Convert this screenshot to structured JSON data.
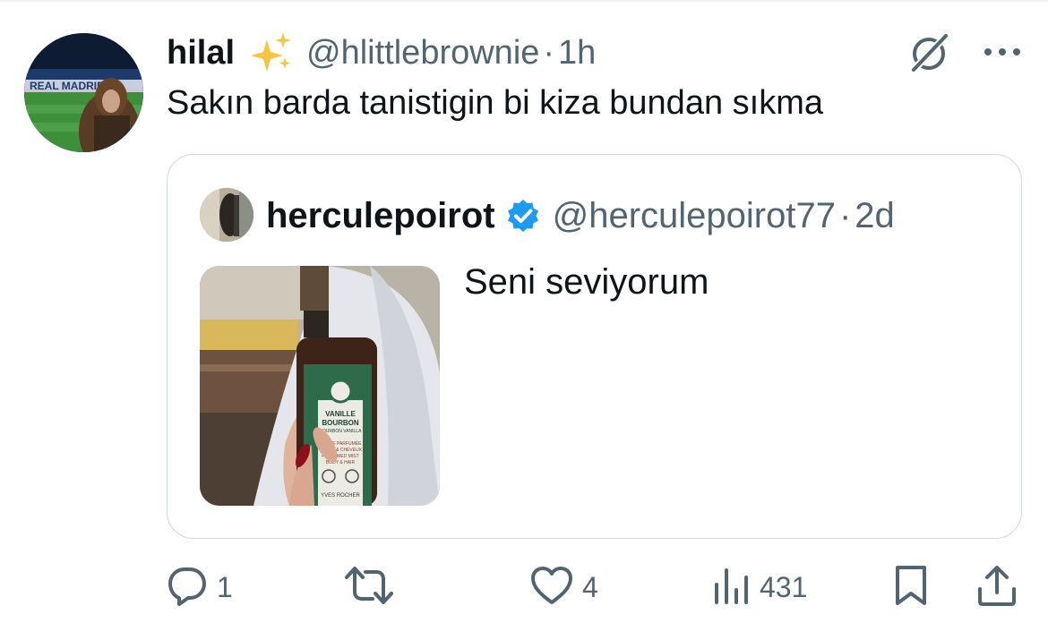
{
  "tweet": {
    "author_name": "hilal",
    "emoji": "✨",
    "handle": "@hlittlebrownie",
    "separator": "·",
    "time": "1h",
    "text": "Sakın barda tanistigin bi kiza bundan sıkma"
  },
  "quoted": {
    "author_name": "herculepoirot",
    "verified": true,
    "handle": "@herculepoirot77",
    "separator": "·",
    "time": "2d",
    "text": "Seni seviyorum",
    "media": {
      "icon": "product-photo",
      "product_lines": [
        "VANILLE",
        "BOURBON",
        "BOURBON VANILLA",
        "BRUME PARFUMÉE",
        "CORPS & CHEVEUX",
        "PERFUMED MIST",
        "BODY & HAIR",
        "YVES ROCHER"
      ]
    }
  },
  "actions": {
    "reply_count": "1",
    "retweet_count": "",
    "like_count": "4",
    "views_count": "431"
  },
  "icons": {
    "sparkle": "sparkles-emoji",
    "grok": "grok-icon",
    "more": "more-icon",
    "verified": "verified-badge-icon",
    "reply": "reply-icon",
    "retweet": "retweet-icon",
    "like": "heart-icon",
    "views": "views-icon",
    "bookmark": "bookmark-icon",
    "share": "share-icon"
  },
  "colors": {
    "text_primary": "#0f1419",
    "text_secondary": "#536471",
    "verified_blue": "#1d9bf0",
    "border": "#cfd9de"
  }
}
